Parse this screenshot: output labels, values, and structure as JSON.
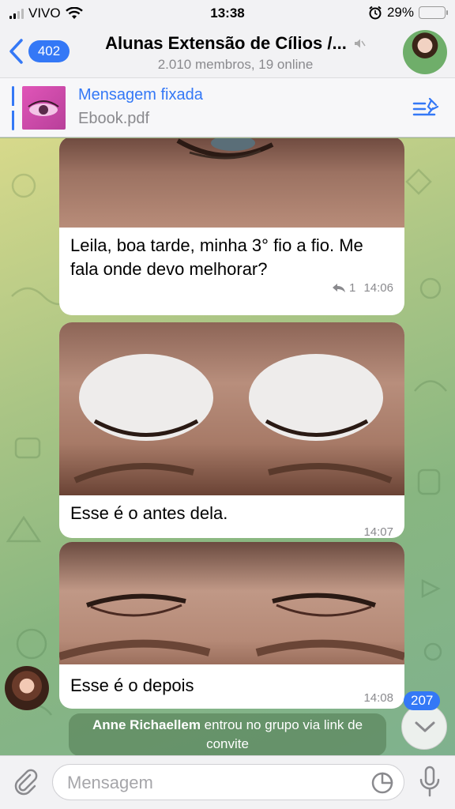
{
  "status_bar": {
    "carrier": "VIVO",
    "time": "13:38",
    "battery": "29%",
    "battery_level": 0.29
  },
  "header": {
    "back_count": "402",
    "title": "Alunas Extensão de Cílios /...",
    "subtitle": "2.010 membros, 19 online",
    "muted_icon": "speaker-muted-icon"
  },
  "pinned": {
    "title": "Mensagem fixada",
    "file": "Ebook.pdf"
  },
  "messages": [
    {
      "text": "Leila, boa tarde,  minha 3° fio a fio. Me fala onde devo melhorar?",
      "replies": "1",
      "time": "14:06"
    },
    {
      "text": "Esse é o antes dela.",
      "time": "14:07"
    },
    {
      "text": "Esse é o depois",
      "time": "14:08"
    }
  ],
  "service": {
    "name": "Anne Richaellem",
    "text": " entrou no grupo via link de convite"
  },
  "unread_badge": "207",
  "input": {
    "placeholder": "Mensagem"
  },
  "colors": {
    "accent": "#3478f6",
    "bubble": "#ffffff",
    "chat_bg": "#a9c585"
  }
}
